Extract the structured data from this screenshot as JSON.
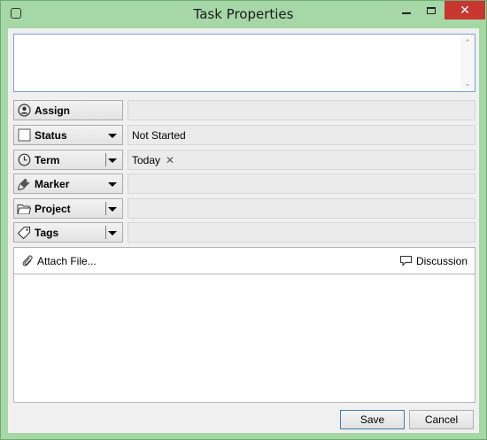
{
  "window": {
    "title": "Task Properties",
    "close_glyph": "✕",
    "accent_color": "#a6d7a7"
  },
  "description": {
    "value": "",
    "scroll_up_glyph": "⌃",
    "scroll_down_glyph": "⌄"
  },
  "properties": {
    "assign": {
      "label": "Assign",
      "icon": "user-circle-icon",
      "value": ""
    },
    "status": {
      "label": "Status",
      "icon": "checkbox-icon",
      "value": "Not Started"
    },
    "term": {
      "label": "Term",
      "icon": "clock-icon",
      "value": "Today",
      "clear_glyph": "✕"
    },
    "marker": {
      "label": "Marker",
      "icon": "marker-brush-icon",
      "value": ""
    },
    "project": {
      "label": "Project",
      "icon": "folder-icon",
      "value": ""
    },
    "tags": {
      "label": "Tags",
      "icon": "tag-icon",
      "value": ""
    }
  },
  "attachments": {
    "attach_label": "Attach File...",
    "discussion_label": "Discussion"
  },
  "buttons": {
    "save": "Save",
    "cancel": "Cancel"
  }
}
